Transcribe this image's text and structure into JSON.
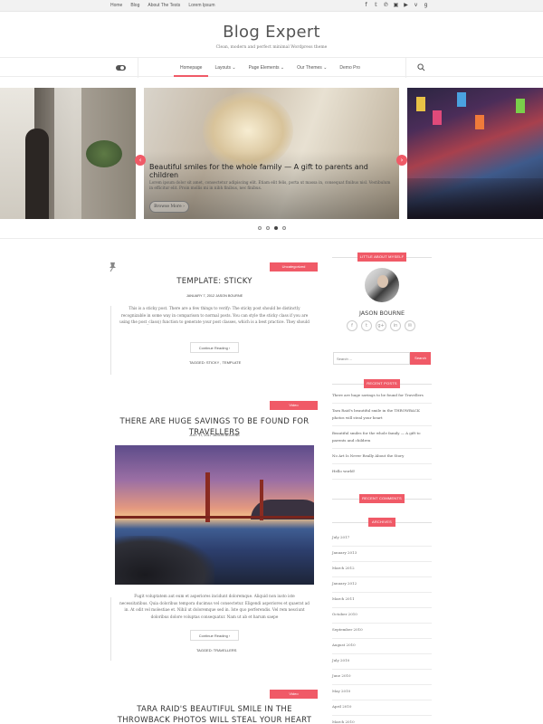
{
  "topbar": {
    "links": [
      "Home",
      "Blog",
      "About The Tests",
      "Lorem Ipsum"
    ],
    "social_icons": [
      "facebook-icon",
      "twitter-icon",
      "pinterest-icon",
      "linkedin-icon",
      "youtube-icon",
      "vimeo-icon",
      "google-plus-icon"
    ]
  },
  "site": {
    "title": "Blog Expert",
    "tagline": "Clean, modern and perfect minimal Wordpress theme"
  },
  "nav": {
    "items": [
      "Homepage",
      "Layouts",
      "Page Elements",
      "Our Themes",
      "Demo Pro"
    ],
    "dropdown_caret": "⌄"
  },
  "slider": {
    "title": "Beautiful smiles for the whole family — A gift to parents and children",
    "text": "Lorem ipsum dolor sit amet, consectetur adipiscing elit. Etiam elit felis, porta ut massa in, consequat finibus nisl. Vestibulum in efficitur elit. Proin mollis mi in nibh finibus, nec finibus.",
    "button": "Browse More ›",
    "prev": "‹",
    "next": "›"
  },
  "posts": [
    {
      "category": "Uncategorized",
      "title": "TEMPLATE: STICKY",
      "meta": "JANUARY 7, 2012     JASON BOURNE",
      "excerpt": "This is a sticky post. There are a few things to verify: The sticky post should be distinctly recognizable in some way in comparison to normal posts. You can style the sticky class if you are using the post_class() function to generate your post classes, which is a best practice. They should",
      "more": "Continue Reading ›",
      "tags": "TAGGED: STICKY , TEMPLATE"
    },
    {
      "category": "Video",
      "title": "THERE ARE HUGE SAVINGS TO BE FOUND FOR TRAVELLERS",
      "meta": "JULY 17, 2017     JASON BOURNE",
      "excerpt": "Fugit voluptatem aut eum et asperiores incidunt doloremque. Aliquid non iusto iste necessitatibus. Quia doloribus tempora ducimus vel consectetur. Eligendi asperiores et quaerat ad in. At odit vel molestiae et. Nihil ut doloremque sed in. Iste quo perferendis. Vel rem nesciunt doloribus dolore voluptas consequatur. Nam ut ab et harum saepe",
      "more": "Continue Reading ›",
      "tags": "TAGGED: TRAVELLERS"
    },
    {
      "category": "Video",
      "title": "TARA RAID'S BEAUTIFUL SMILE IN THE THROWBACK PHOTOS WILL STEAL YOUR HEART"
    }
  ],
  "sidebar": {
    "about_title": "LITTLE ABOUT MYSELF",
    "author": "JASON BOURNE",
    "author_social": [
      "f",
      "t",
      "g+",
      "in",
      "✉"
    ],
    "search_placeholder": "Search ...",
    "search_button": "Search",
    "recent_title": "RECENT POSTS",
    "recent_posts": [
      "There are huge savings to be found for Travellers",
      "Tara Raid's beautiful smile in the THROWBACK photos will steal your heart",
      "Beautiful smiles for the whole family — A gift to parents and children",
      "No Art Is Never Really About the Story",
      "Hello world!"
    ],
    "comments_title": "RECENT COMMENTS",
    "archives_title": "ARCHIVES",
    "archives": [
      "July 2017",
      "January 2013",
      "March 2012",
      "January 2012",
      "March 2011",
      "October 2010",
      "September 2010",
      "August 2010",
      "July 2010",
      "June 2010",
      "May 2010",
      "April 2010",
      "March 2010"
    ]
  },
  "colors": {
    "accent": "#f05a67"
  }
}
